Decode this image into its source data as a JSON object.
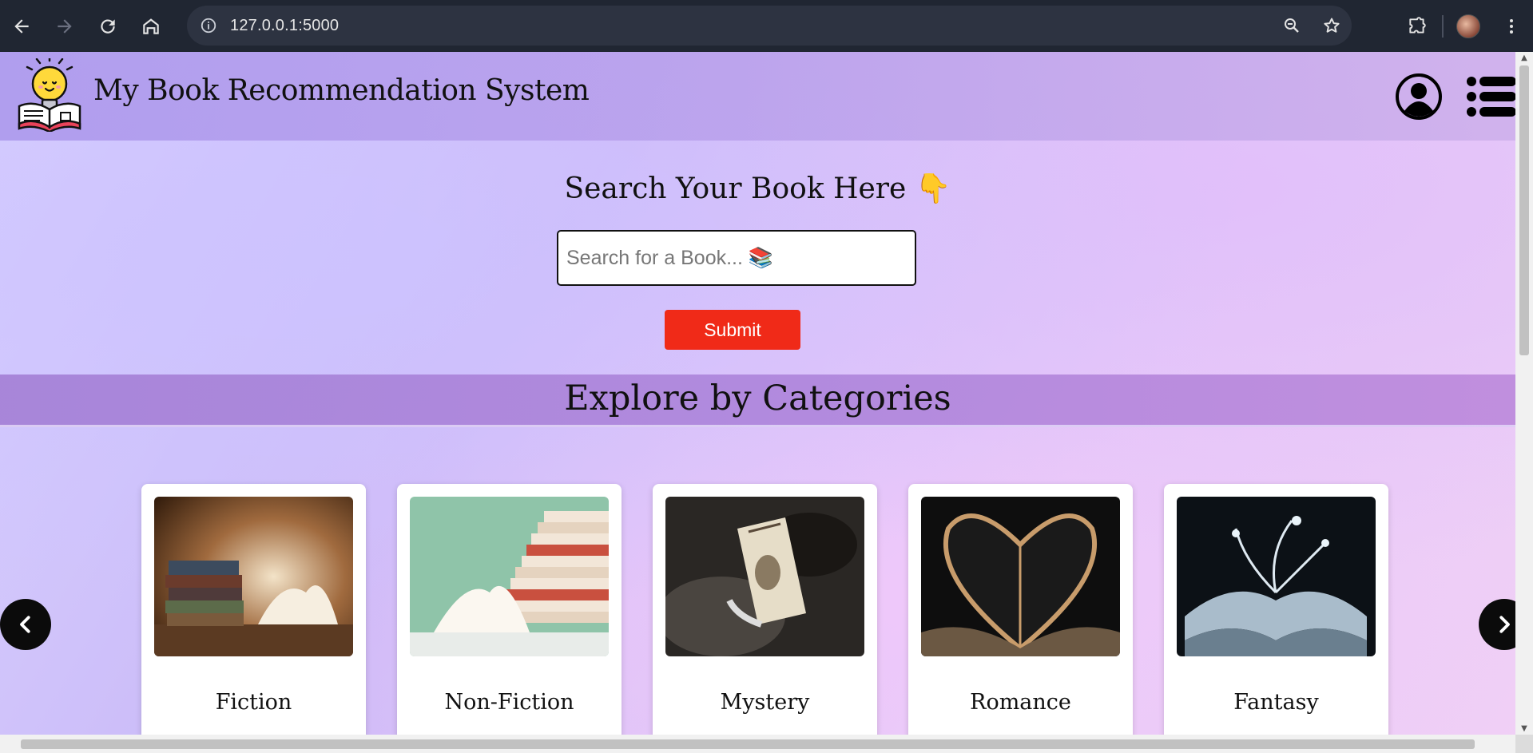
{
  "browser": {
    "url": "127.0.0.1:5000",
    "icons": [
      "back-icon",
      "forward-icon",
      "reload-icon",
      "home-icon",
      "site-info-icon",
      "zoom-icon",
      "bookmark-star-icon",
      "extensions-icon",
      "profile-avatar",
      "more-menu-icon"
    ]
  },
  "header": {
    "title": "My Book Recommendation System",
    "icons": [
      "lightbulb-book-logo",
      "user-account-icon",
      "list-menu-icon"
    ]
  },
  "search": {
    "title": "Search Your Book Here 👇",
    "placeholder": "Search for a Book... 📚",
    "submit_label": "Submit"
  },
  "categories": {
    "title": "Explore by Categories",
    "items": [
      {
        "label": "Fiction"
      },
      {
        "label": "Non-Fiction"
      },
      {
        "label": "Mystery"
      },
      {
        "label": "Romance"
      },
      {
        "label": "Fantasy"
      }
    ]
  },
  "colors": {
    "chrome_bg": "#202632",
    "submit_bg": "#f02a18",
    "header_bg": "#b09be8",
    "band_bg": "#a884d8"
  }
}
